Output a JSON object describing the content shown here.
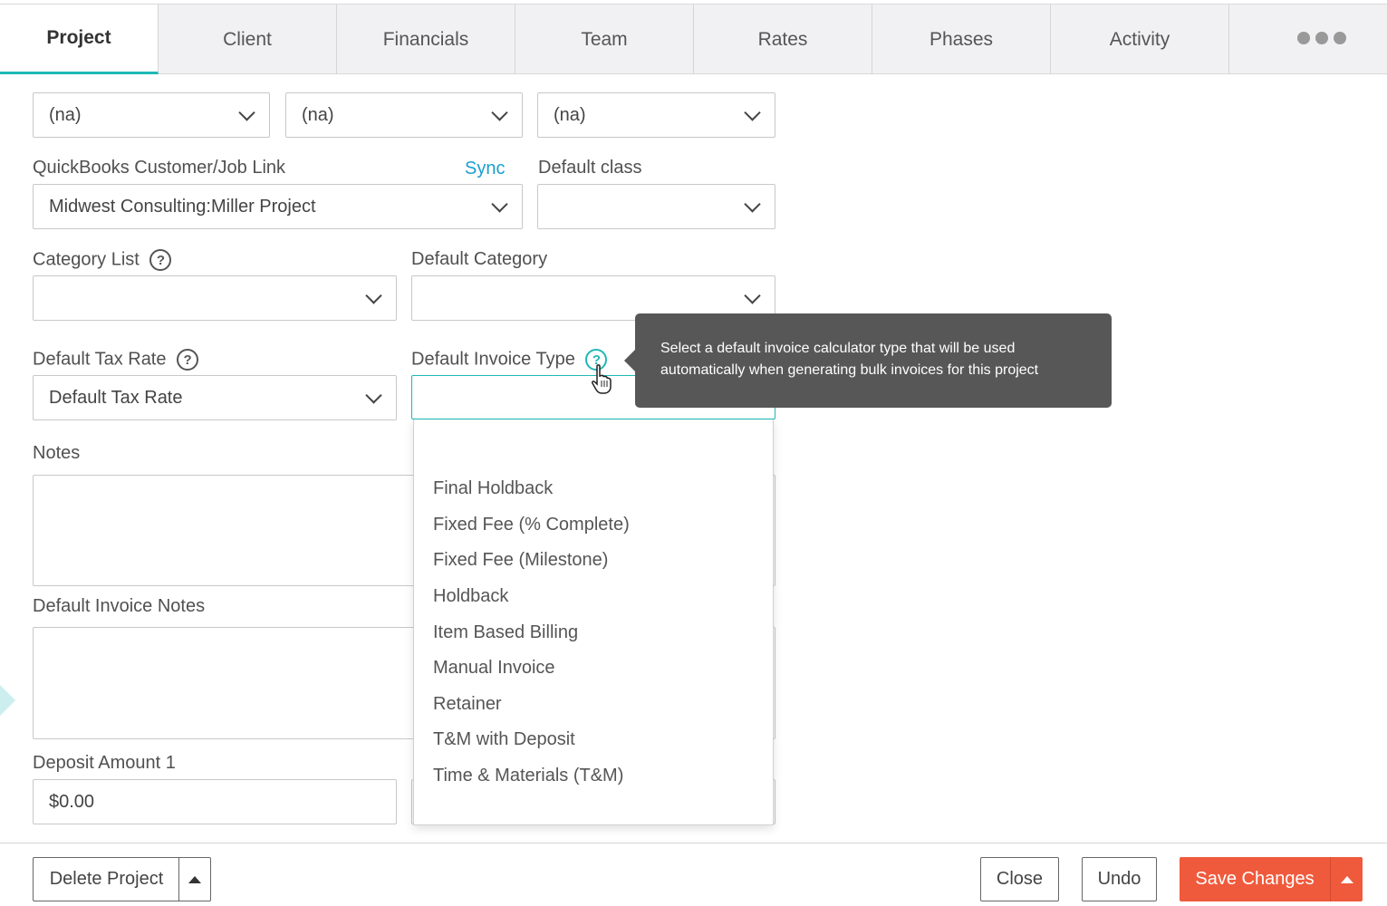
{
  "tabs": [
    "Project",
    "Client",
    "Financials",
    "Team",
    "Rates",
    "Phases",
    "Activity"
  ],
  "active_tab": "Project",
  "row1": {
    "select1": "(na)",
    "select2": "(na)",
    "select3": "(na)"
  },
  "quickbooks": {
    "label": "QuickBooks Customer/Job Link",
    "sync": "Sync",
    "value": "Midwest Consulting:Miller Project"
  },
  "default_class": {
    "label": "Default class",
    "value": ""
  },
  "category_list": {
    "label": "Category List",
    "value": ""
  },
  "default_category": {
    "label": "Default Category",
    "value": ""
  },
  "tax_rate": {
    "label": "Default Tax Rate",
    "value": "Default Tax Rate"
  },
  "invoice_type": {
    "label": "Default Invoice Type",
    "value": "",
    "options": [
      "Final Holdback",
      "Fixed Fee (% Complete)",
      "Fixed Fee (Milestone)",
      "Holdback",
      "Item Based Billing",
      "Manual Invoice",
      "Retainer",
      "T&M with Deposit",
      "Time & Materials (T&M)"
    ]
  },
  "tooltip": "Select a default invoice calculator type that will be used automatically when generating bulk invoices for this project",
  "notes": {
    "label": "Notes"
  },
  "invoice_notes": {
    "label": "Default Invoice Notes"
  },
  "deposit": {
    "label": "Deposit Amount 1",
    "value": "$0.00"
  },
  "footer": {
    "delete": "Delete Project",
    "close": "Close",
    "undo": "Undo",
    "save": "Save Changes"
  },
  "colors": {
    "accent": "#1eb8b5",
    "save": "#f05a3c",
    "link": "#1a9fd0"
  },
  "icons": [
    "chevron-down-icon",
    "help-icon",
    "caret-up-icon",
    "more-icon",
    "hand-cursor-icon"
  ]
}
